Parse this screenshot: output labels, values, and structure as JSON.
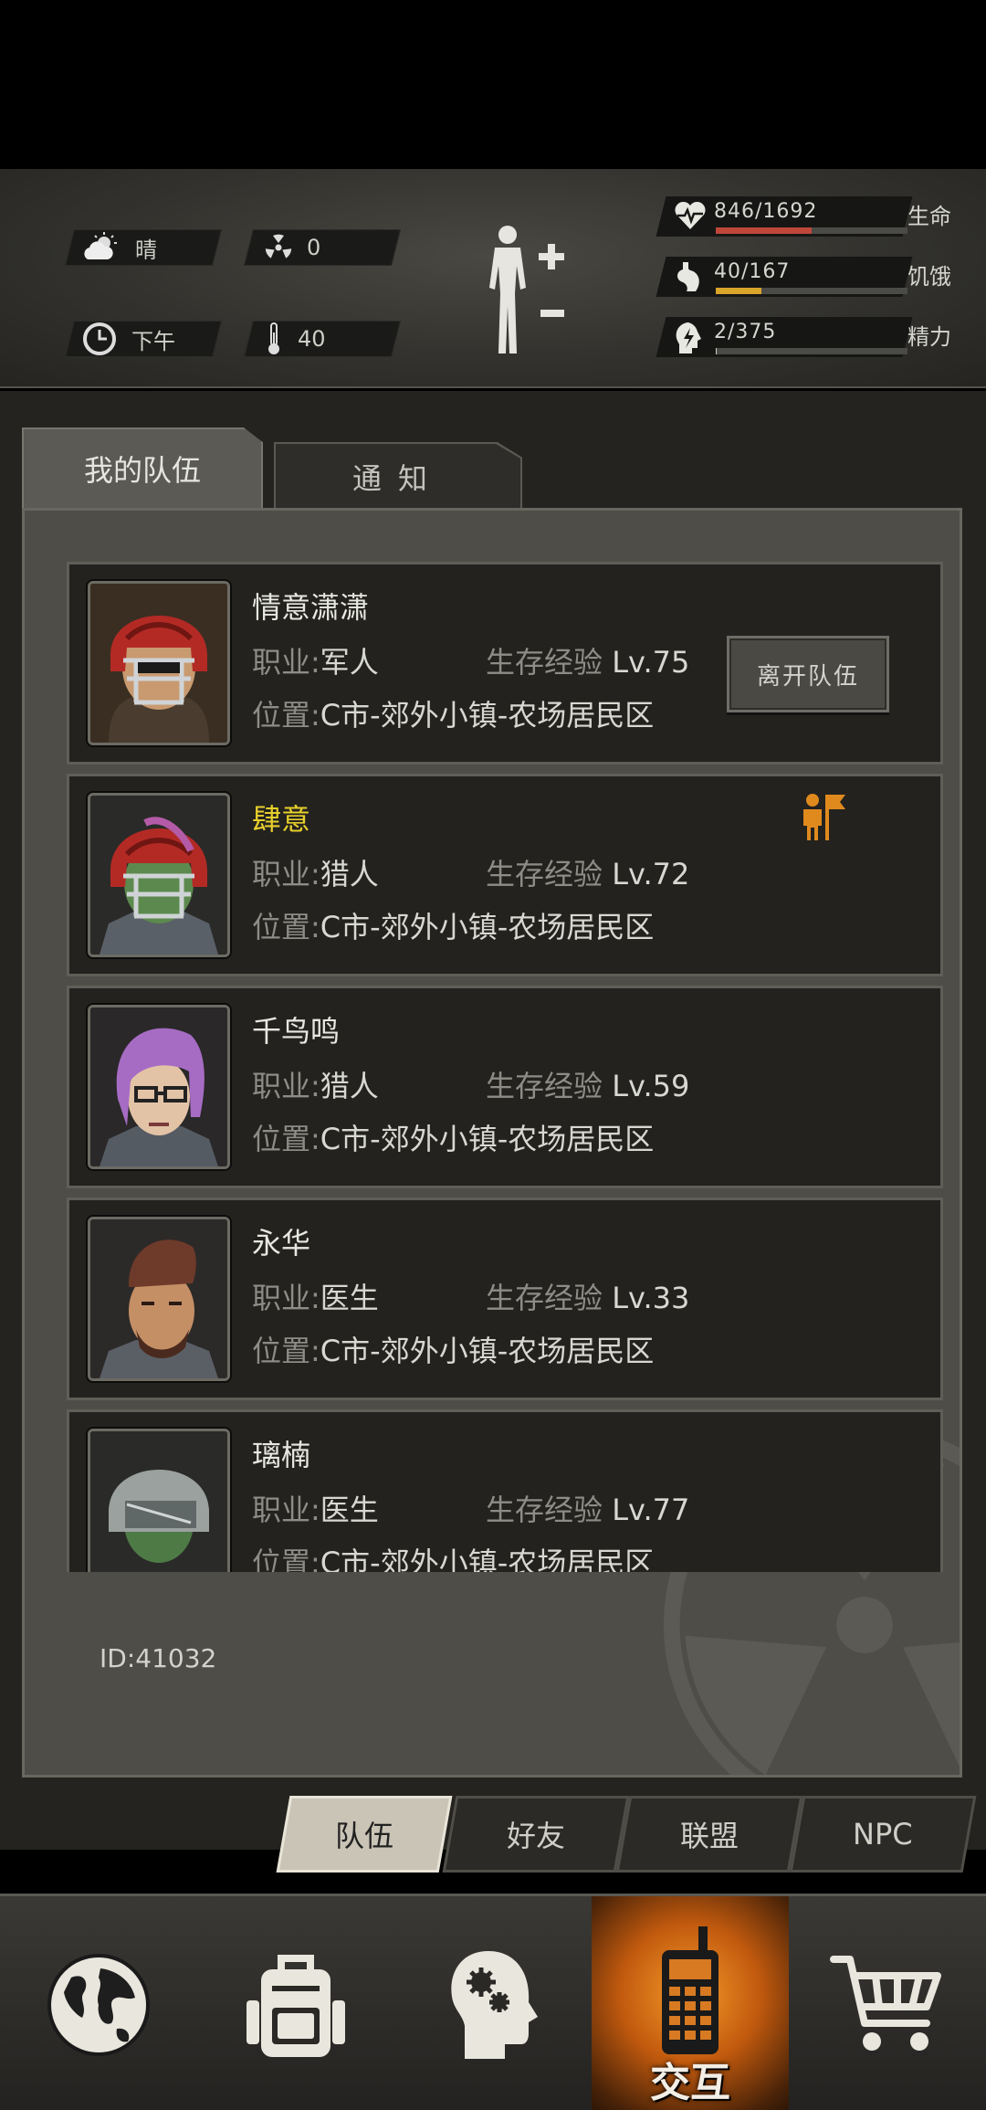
{
  "hud": {
    "weather": "晴",
    "radiation": "0",
    "time_of_day": "下午",
    "temperature": "40",
    "stats": [
      {
        "id": "health",
        "value": "846/1692",
        "label": "生命",
        "fraction": 0.5,
        "color": "#c0463a"
      },
      {
        "id": "hunger",
        "value": "40/167",
        "label": "饥饿",
        "fraction": 0.24,
        "color": "#d9a42a"
      },
      {
        "id": "energy",
        "value": "2/375",
        "label": "精力",
        "fraction": 0.005,
        "color": "#cfcfc8"
      }
    ]
  },
  "tabs": {
    "my_team": "我的队伍",
    "notice": "通知"
  },
  "labels": {
    "role": "职业",
    "location": "位置",
    "exp": "生存经验",
    "colon": ":"
  },
  "members": [
    {
      "name": "情意潇潇",
      "role": "军人",
      "level": "Lv.75",
      "location": "C市-郊外小镇-农场居民区",
      "action": "离开队伍",
      "leader": false
    },
    {
      "name": "肆意",
      "role": "猎人",
      "level": "Lv.72",
      "location": "C市-郊外小镇-农场居民区",
      "leader": true
    },
    {
      "name": "千鸟鸣",
      "role": "猎人",
      "level": "Lv.59",
      "location": "C市-郊外小镇-农场居民区",
      "leader": false
    },
    {
      "name": "永华",
      "role": "医生",
      "level": "Lv.33",
      "location": "C市-郊外小镇-农场居民区",
      "leader": false
    },
    {
      "name": "璃楠",
      "role": "医生",
      "level": "Lv.77",
      "location": "C市-郊外小镇-农场居民区",
      "leader": false
    }
  ],
  "player_id": "ID:41032",
  "subtabs": [
    "队伍",
    "好友",
    "联盟",
    "NPC"
  ],
  "nav": {
    "interact_label": "交互"
  },
  "icons": {
    "weather": "sun-cloud-icon",
    "radiation": "radiation-icon",
    "clock": "clock-icon",
    "temperature": "thermometer-icon",
    "body": "body-status-icon",
    "health": "heart-pulse-icon",
    "hunger": "stomach-icon",
    "energy": "brain-bolt-icon",
    "leader": "leader-flag-icon",
    "nav": [
      "globe-icon",
      "backpack-icon",
      "head-gears-icon",
      "walkie-talkie-icon",
      "cart-icon"
    ]
  }
}
